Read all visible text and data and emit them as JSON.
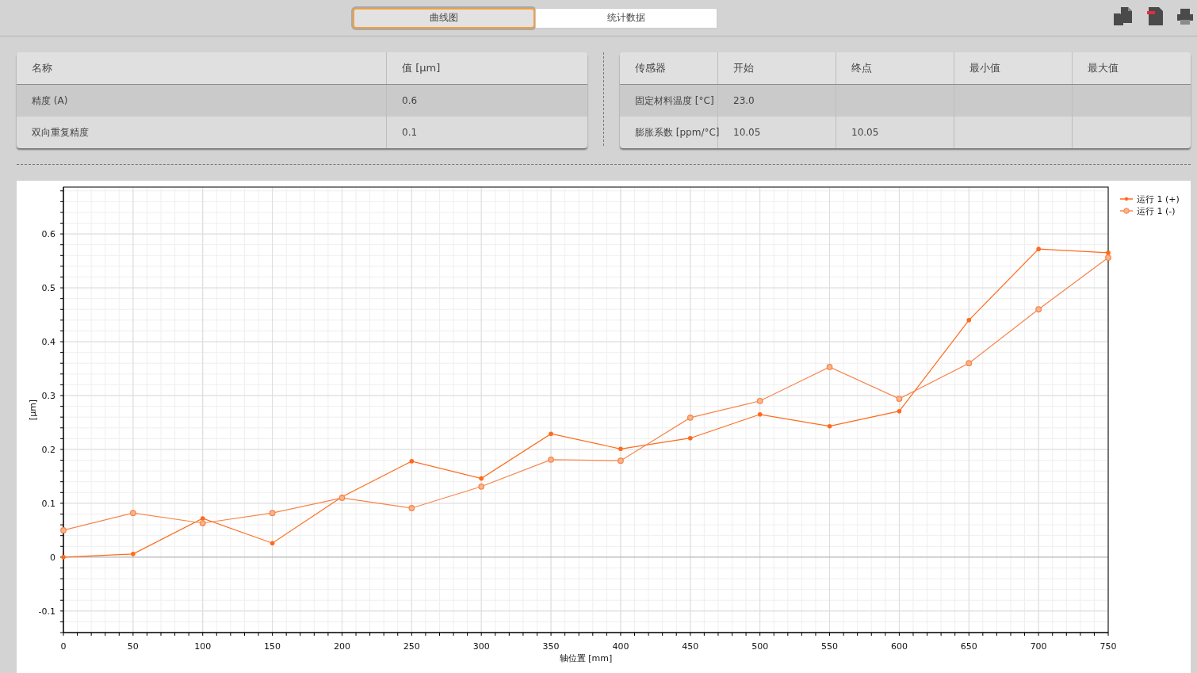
{
  "view_tabs": [
    {
      "label": "曲线图",
      "selected": true
    },
    {
      "label": "统计数据",
      "selected": false
    }
  ],
  "results_table": {
    "columns": [
      "名称",
      "值 [µm]"
    ],
    "rows": [
      [
        "精度 (A)",
        "0.6"
      ],
      [
        "双向重复精度",
        "0.1"
      ]
    ]
  },
  "sensor_table": {
    "columns": [
      "传感器",
      "开始",
      "终点",
      "最小值",
      "最大值"
    ],
    "rows": [
      [
        "固定材料温度 [°C]",
        "23.0",
        "",
        "",
        ""
      ],
      [
        "膨胀系数 [ppm/°C]",
        "10.05",
        "10.05",
        "",
        ""
      ]
    ]
  },
  "chart": {
    "chart_data": {
      "type": "line",
      "xlabel": "轴位置 [mm]",
      "ylabel": "[µm]",
      "x": [
        0,
        50,
        100,
        150,
        200,
        250,
        300,
        350,
        400,
        450,
        500,
        550,
        600,
        650,
        700,
        750
      ],
      "xlim": [
        0,
        750
      ],
      "ylim": [
        -0.14,
        0.687
      ],
      "xticks": [
        0,
        50,
        100,
        150,
        200,
        250,
        300,
        350,
        400,
        450,
        500,
        550,
        600,
        650,
        700,
        750
      ],
      "yticks": [
        -0.1,
        0,
        0.1,
        0.2,
        0.3,
        0.4,
        0.5,
        0.6
      ],
      "grid": true,
      "legend": true,
      "series": [
        {
          "name": "运行 1 (+)",
          "color": "#ff6a1a",
          "values": [
            0,
            0.006,
            0.072,
            0.026,
            0.112,
            0.178,
            0.146,
            0.229,
            0.201,
            0.221,
            0.265,
            0.243,
            0.271,
            0.44,
            0.572,
            0.565
          ]
        },
        {
          "name": "运行 1 (-)",
          "color": "#f7844a",
          "marker": "circle",
          "values": [
            0.05,
            0.082,
            0.063,
            0.082,
            0.11,
            0.091,
            0.131,
            0.181,
            0.179,
            0.259,
            0.29,
            0.353,
            0.294,
            0.36,
            0.46,
            0.556
          ]
        }
      ]
    }
  }
}
